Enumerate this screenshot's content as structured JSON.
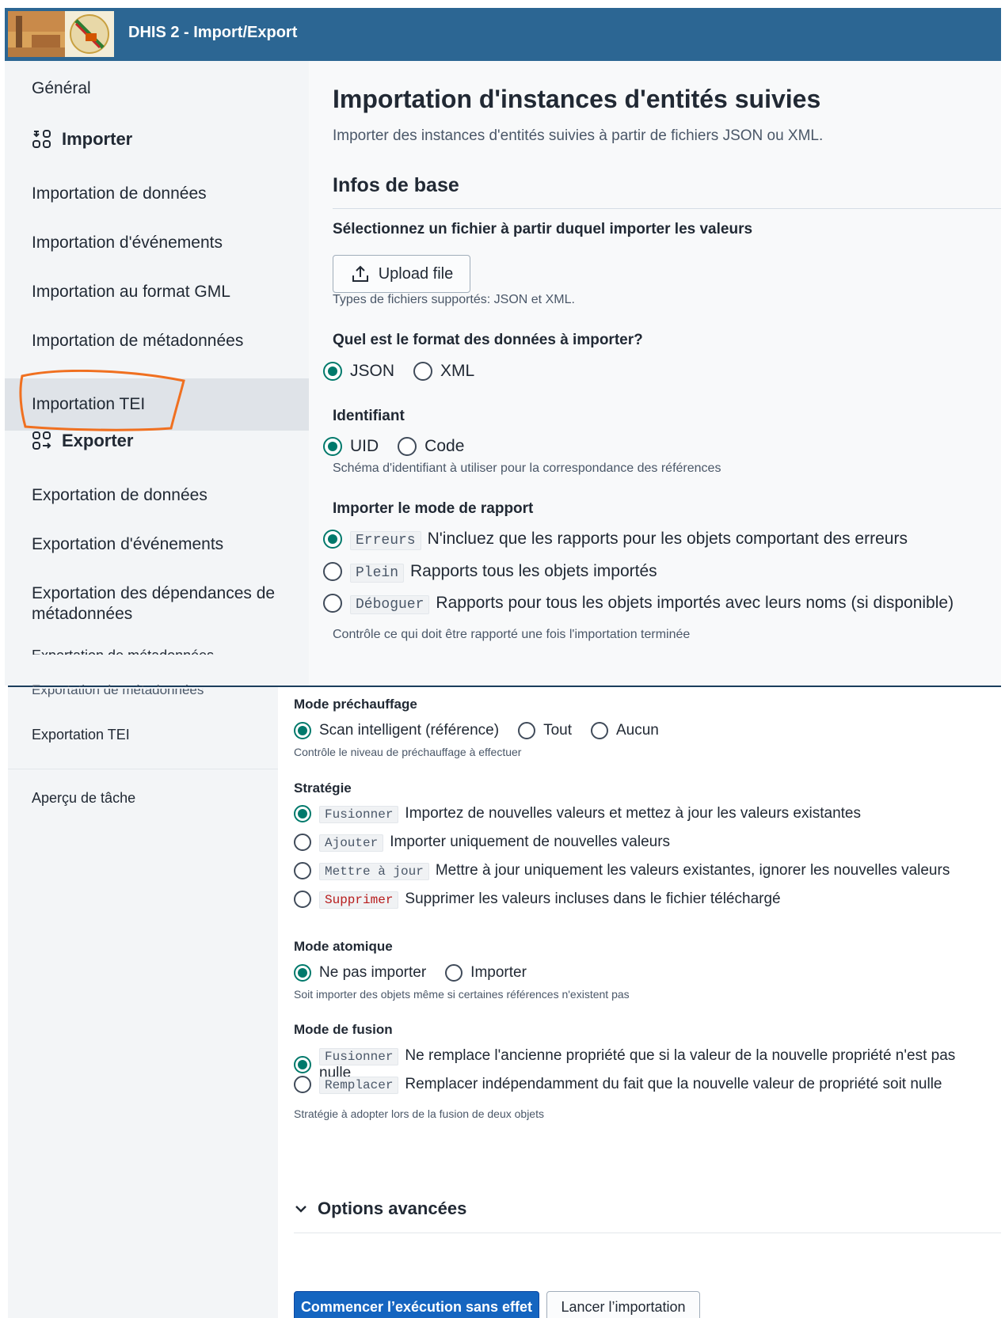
{
  "header": {
    "app_title": "DHIS 2 - Import/Export",
    "bg_color": "#2c6693"
  },
  "sidebar": {
    "general": "Général",
    "import_section": "Importer",
    "import_items": [
      "Importation de données",
      "Importation d'événements",
      "Importation au format GML",
      "Importation de métadonnées",
      "Importation TEI"
    ],
    "export_section": "Exporter",
    "export_items": [
      "Exportation de données",
      "Exportation d'événements",
      "Exportation des dépendances de métadonnées",
      "Exportation de métadonnées",
      "Exportation TEI"
    ],
    "job_overview": "Aperçu de tâche",
    "active_item": "Importation TEI"
  },
  "main": {
    "title": "Importation d'instances d'entités suivies",
    "description": "Importer des instances d'entités suivies à partir de fichiers JSON ou XML.",
    "section_title": "Infos de base",
    "file": {
      "label": "Sélectionnez un fichier à partir duquel importer les valeurs",
      "button": "Upload file",
      "help": "Types de fichiers supportés: JSON et XML."
    },
    "format": {
      "label": "Quel est le format des données à importer?",
      "options": [
        "JSON",
        "XML"
      ],
      "selected": "JSON"
    },
    "identifier": {
      "label": "Identifiant",
      "options": [
        "UID",
        "Code"
      ],
      "selected": "UID",
      "help": "Schéma d'identifiant à utiliser pour la correspondance des références"
    },
    "report_mode": {
      "label": "Importer le mode de rapport",
      "options": [
        {
          "code": "Erreurs",
          "text": "N'incluez que les rapports pour les objets comportant des erreurs",
          "selected": true
        },
        {
          "code": "Plein",
          "text": "Rapports tous les objets importés",
          "selected": false
        },
        {
          "code": "Déboguer",
          "text": "Rapports pour tous les objets importés avec leurs noms (si disponible)",
          "selected": false
        }
      ],
      "help": "Contrôle ce qui doit être rapporté une fois l'importation terminée"
    },
    "preheat": {
      "label": "Mode préchauffage",
      "options": [
        "Scan intelligent (référence)",
        "Tout",
        "Aucun"
      ],
      "selected": "Scan intelligent (référence)",
      "help": "Contrôle le niveau de préchauffage à effectuer"
    },
    "strategy": {
      "label": "Stratégie",
      "options": [
        {
          "code": "Fusionner",
          "text": "Importez de nouvelles valeurs et mettez à jour les valeurs existantes",
          "selected": true
        },
        {
          "code": "Ajouter",
          "text": "Importer uniquement de nouvelles valeurs",
          "selected": false
        },
        {
          "code": "Mettre à jour",
          "text": "Mettre à jour uniquement les valeurs existantes, ignorer les nouvelles valeurs",
          "selected": false
        },
        {
          "code": "Supprimer",
          "text": "Supprimer les valeurs incluses dans le fichier téléchargé",
          "selected": false
        }
      ]
    },
    "atomic": {
      "label": "Mode atomique",
      "options": [
        "Ne pas importer",
        "Importer"
      ],
      "selected": "Ne pas importer",
      "help": "Soit importer des objets même si certaines références n'existent pas"
    },
    "merge_mode": {
      "label": "Mode de fusion",
      "options": [
        {
          "code": "Fusionner",
          "text": "Ne remplace l'ancienne propriété que si la valeur de la nouvelle propriété n'est pas nulle",
          "selected": true
        },
        {
          "code": "Remplacer",
          "text": "Remplacer indépendamment du fait que la nouvelle valeur de propriété soit nulle",
          "selected": false
        }
      ],
      "help": "Stratégie à adopter lors de la fusion de deux objets"
    },
    "advanced_options": "Options avancées",
    "buttons": {
      "dry_run": "Commencer l’exécution sans effet",
      "import": "Lancer l’importation"
    }
  },
  "colors": {
    "accent_green": "#00796b",
    "primary_blue": "#1565c0",
    "annotation_orange": "#f07020"
  }
}
